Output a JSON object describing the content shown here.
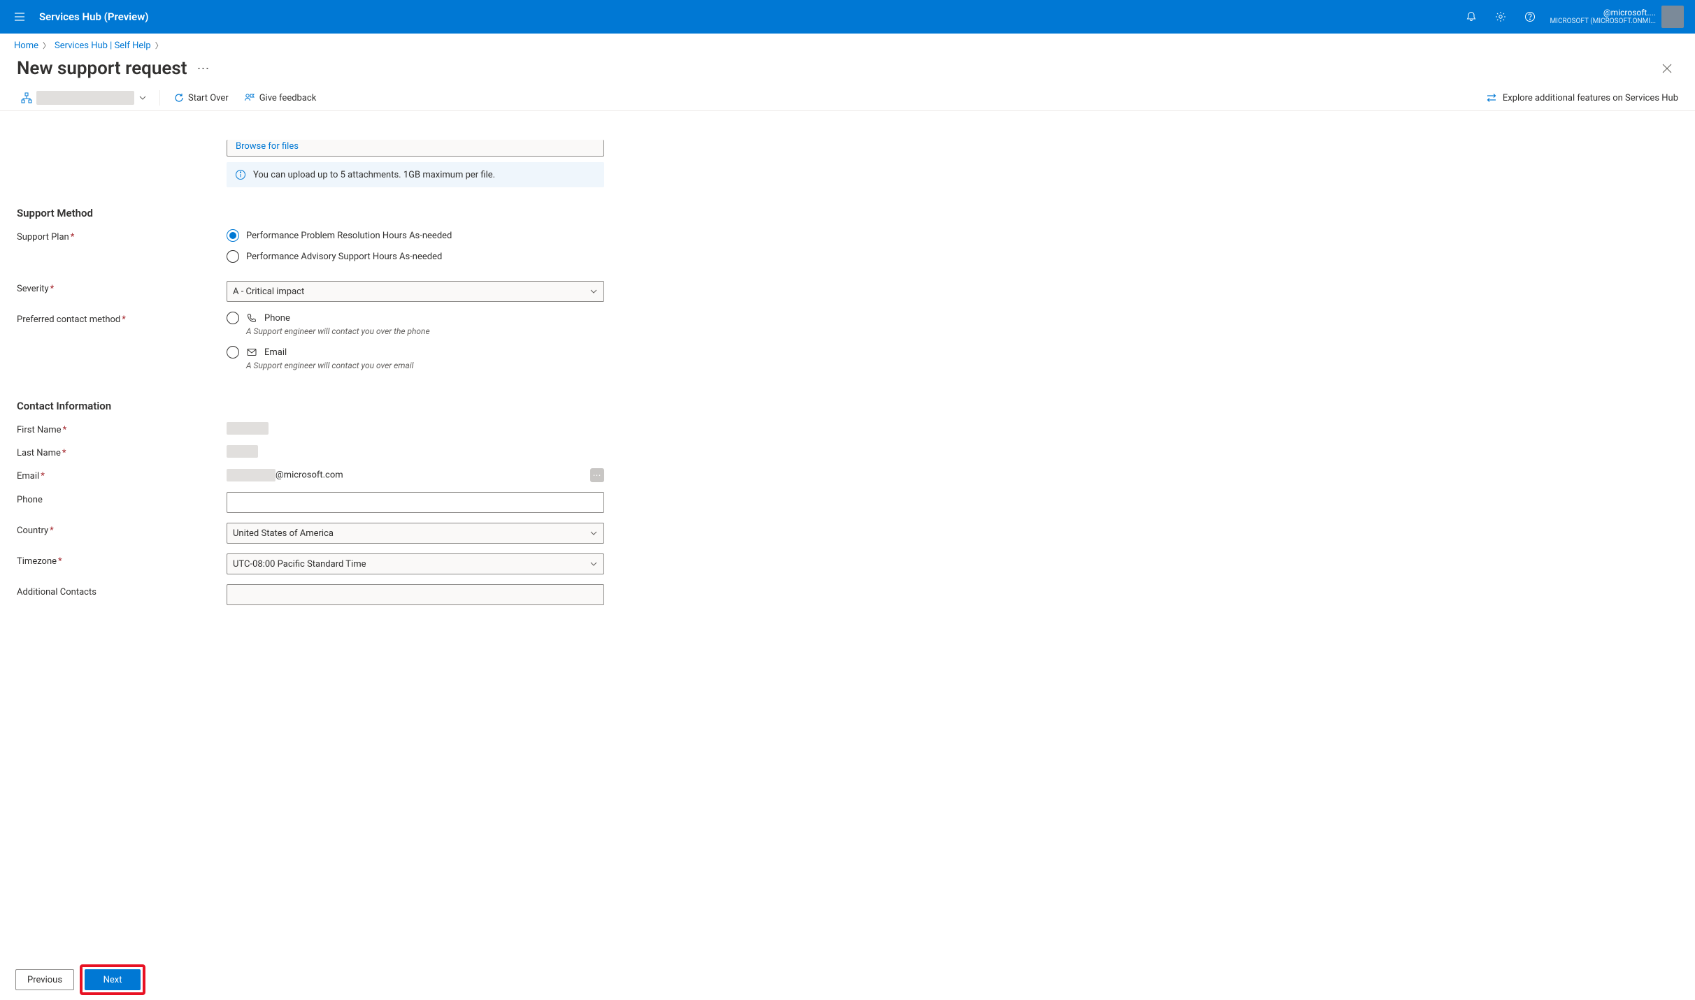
{
  "topbar": {
    "title": "Services Hub (Preview)",
    "account_email": "@microsoft....",
    "account_tenant": "MICROSOFT (MICROSOFT.ONMI..."
  },
  "breadcrumb": {
    "home": "Home",
    "self_help": "Services Hub | Self Help"
  },
  "page": {
    "title": "New support request"
  },
  "commands": {
    "start_over": "Start Over",
    "give_feedback": "Give feedback",
    "explore": "Explore additional features on Services Hub"
  },
  "attachments": {
    "browse": "Browse for files",
    "info": "You can upload up to 5 attachments. 1GB maximum per file."
  },
  "sections": {
    "support_method": "Support Method",
    "contact_info": "Contact Information"
  },
  "labels": {
    "support_plan": "Support Plan",
    "severity": "Severity",
    "preferred_contact": "Preferred contact method",
    "first_name": "First Name",
    "last_name": "Last Name",
    "email": "Email",
    "phone": "Phone",
    "country": "Country",
    "timezone": "Timezone",
    "additional_contacts": "Additional Contacts"
  },
  "support_plan": {
    "option1": "Performance Problem Resolution Hours As-needed",
    "option2": "Performance Advisory Support Hours As-needed"
  },
  "severity": {
    "value": "A - Critical impact"
  },
  "contact_method": {
    "phone_label": "Phone",
    "phone_desc": "A Support engineer will contact you over the phone",
    "email_label": "Email",
    "email_desc": "A Support engineer will contact you over email"
  },
  "contact": {
    "email_domain": "@microsoft.com",
    "country": "United States of America",
    "timezone": "UTC-08:00 Pacific Standard Time"
  },
  "footer": {
    "previous": "Previous",
    "next": "Next"
  }
}
